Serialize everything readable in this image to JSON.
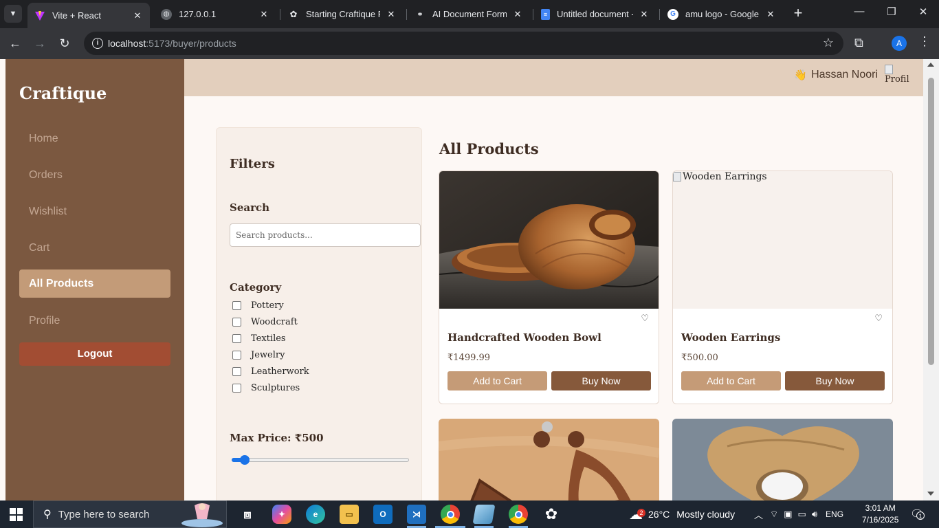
{
  "browser": {
    "tabs": [
      {
        "title": "Vite + React",
        "active": true
      },
      {
        "title": "127.0.0.1",
        "active": false
      },
      {
        "title": "Starting Craftique Fre",
        "active": false
      },
      {
        "title": "AI Document Formatt",
        "active": false
      },
      {
        "title": "Untitled document - C",
        "active": false
      },
      {
        "title": "amu logo - Google Se",
        "active": false
      }
    ],
    "url_host": "localhost",
    "url_path": ":5173/buyer/products",
    "profile_initial": "A"
  },
  "app": {
    "brand": "Craftique",
    "nav": [
      "Home",
      "Orders",
      "Wishlist",
      "Cart",
      "All Products",
      "Profile"
    ],
    "active_nav": "All Products",
    "logout_label": "Logout",
    "user_name": "Hassan Noori",
    "wave_emoji": "👋",
    "profile_alt": "Profile"
  },
  "filters": {
    "title": "Filters",
    "search_label": "Search",
    "search_placeholder": "Search products...",
    "category_label": "Category",
    "categories": [
      "Pottery",
      "Woodcraft",
      "Textiles",
      "Jewelry",
      "Leatherwork",
      "Sculptures"
    ],
    "max_price_label": "Max Price: ₹500",
    "max_price_value": 500,
    "slider_fraction": 0.05
  },
  "products": {
    "title": "All Products",
    "items": [
      {
        "name": "Handcrafted Wooden Bowl",
        "price": "₹1499.99",
        "image_alt": "Handcrafted Wooden Bowl",
        "image_loaded": true
      },
      {
        "name": "Wooden Earrings",
        "price": "₹500.00",
        "image_alt": "Wooden Earrings",
        "image_loaded": false
      }
    ],
    "add_to_cart_label": "Add to Cart",
    "buy_now_label": "Buy Now"
  },
  "taskbar": {
    "search_placeholder": "Type here to search",
    "weather_temp": "26°C",
    "weather_text": "Mostly cloudy",
    "weather_badge": "2",
    "language": "ENG",
    "time": "3:01 AM",
    "date": "7/16/2025",
    "notification_count": "1"
  },
  "colors": {
    "sidebar": "#7b5840",
    "active_nav": "#c39b78",
    "logout": "#a24d33",
    "add_to_cart": "#c59b77",
    "buy_now": "#86593b"
  }
}
